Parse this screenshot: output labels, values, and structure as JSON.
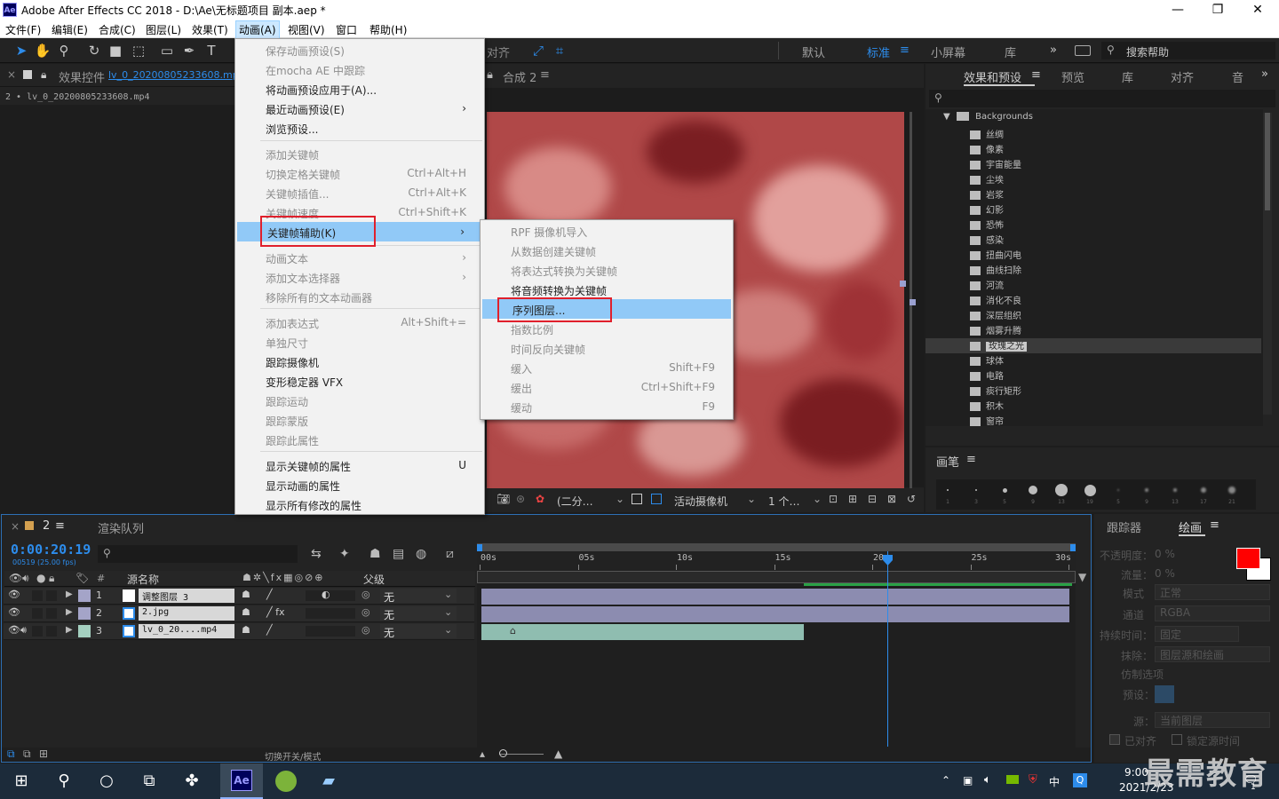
{
  "window": {
    "app_logo": "Ae",
    "title": "Adobe After Effects CC 2018 - D:\\Ae\\无标题项目 副本.aep *",
    "min": "—",
    "max": "❐",
    "close": "✕"
  },
  "menubar": [
    "文件(F)",
    "编辑(E)",
    "合成(C)",
    "图层(L)",
    "效果(T)",
    "动画(A)",
    "视图(V)",
    "窗口",
    "帮助(H)"
  ],
  "toolbar": {
    "align_label": "对齐",
    "workspaces": [
      "默认",
      "标准",
      "小屏幕",
      "库"
    ],
    "more": "»",
    "search_placeholder": "搜索帮助"
  },
  "effect_controls": {
    "tab_prefix": "效果控件",
    "tab_file": "lv_0_20200805233608.mp4",
    "breadcrumb": "2 • lv_0_20200805233608.mp4"
  },
  "composition": {
    "tab": "合成 2"
  },
  "viewer_bar": {
    "resolution": "(二分…",
    "camera": "活动摄像机",
    "views": "1 个…"
  },
  "effects_panel": {
    "tabs": [
      "效果和预设",
      "预览",
      "库",
      "对齐",
      "音"
    ],
    "folder": "Backgrounds",
    "items": [
      "丝绸",
      "像素",
      "宇宙能量",
      "尘埃",
      "岩浆",
      "幻影",
      "恐怖",
      "感染",
      "扭曲闪电",
      "曲线扫除",
      "河流",
      "消化不良",
      "深层组织",
      "烟雾升腾",
      "玫瑰之光",
      "球体",
      "电路",
      "痰行矩形",
      "积木",
      "窗帘"
    ],
    "selected_index": 14
  },
  "brush_panel": {
    "title": "画笔",
    "sizes": [
      "1",
      "3",
      "5",
      "9",
      "13",
      "19",
      "5",
      "9",
      "13",
      "17",
      "21"
    ]
  },
  "paint_panel": {
    "tabs": [
      "跟踪器",
      "绘画"
    ],
    "opacity_label": "不透明度：",
    "opacity_value": "0 %",
    "flow_label": "流量：",
    "flow_value": "0 %",
    "mode_label": "模式",
    "mode_value": "正常",
    "channel_label": "通道",
    "channel_value": "RGBA",
    "duration_label": "持续时间：",
    "duration_value": "固定",
    "erase_label": "抹除：",
    "erase_value": "图层源和绘画",
    "clone_label": "仿制选项",
    "preset_label": "预设：",
    "source_label": "源：",
    "source_value": "当前图层",
    "aligned_label": "已对齐",
    "lock_time_label": "锁定源时间",
    "fg_color": "#ff0000",
    "bg_color": "#ffffff"
  },
  "animation_menu": {
    "items": [
      {
        "label": "保存动画预设(S)",
        "shortcut": "",
        "disabled": true
      },
      {
        "label": "在mocha AE 中跟踪",
        "shortcut": "",
        "disabled": true
      },
      {
        "label": "将动画预设应用于(A)...",
        "shortcut": "",
        "disabled": false
      },
      {
        "label": "最近动画预设(E)",
        "shortcut": "›",
        "disabled": false
      },
      {
        "label": "浏览预设...",
        "shortcut": "",
        "disabled": false
      },
      {
        "label": "添加关键帧",
        "shortcut": "",
        "disabled": true
      },
      {
        "label": "切换定格关键帧",
        "shortcut": "Ctrl+Alt+H",
        "disabled": true
      },
      {
        "label": "关键帧插值...",
        "shortcut": "Ctrl+Alt+K",
        "disabled": true
      },
      {
        "label": "关键帧速度...",
        "shortcut": "Ctrl+Shift+K",
        "disabled": true
      },
      {
        "label": "关键帧辅助(K)",
        "shortcut": "›",
        "disabled": false
      },
      {
        "label": "动画文本",
        "shortcut": "›",
        "disabled": true
      },
      {
        "label": "添加文本选择器",
        "shortcut": "›",
        "disabled": true
      },
      {
        "label": "移除所有的文本动画器",
        "shortcut": "",
        "disabled": true
      },
      {
        "label": "添加表达式",
        "shortcut": "Alt+Shift+=",
        "disabled": true
      },
      {
        "label": "单独尺寸",
        "shortcut": "",
        "disabled": true
      },
      {
        "label": "跟踪摄像机",
        "shortcut": "",
        "disabled": false
      },
      {
        "label": "变形稳定器 VFX",
        "shortcut": "",
        "disabled": false
      },
      {
        "label": "跟踪运动",
        "shortcut": "",
        "disabled": true
      },
      {
        "label": "跟踪蒙版",
        "shortcut": "",
        "disabled": true
      },
      {
        "label": "跟踪此属性",
        "shortcut": "",
        "disabled": true
      },
      {
        "label": "显示关键帧的属性",
        "shortcut": "U",
        "disabled": false
      },
      {
        "label": "显示动画的属性",
        "shortcut": "",
        "disabled": false
      },
      {
        "label": "显示所有修改的属性",
        "shortcut": "",
        "disabled": false
      }
    ]
  },
  "keyframe_submenu": {
    "items": [
      {
        "label": "RPF 摄像机导入",
        "shortcut": "",
        "disabled": true
      },
      {
        "label": "从数据创建关键帧",
        "shortcut": "",
        "disabled": true
      },
      {
        "label": "将表达式转换为关键帧",
        "shortcut": "",
        "disabled": true
      },
      {
        "label": "将音频转换为关键帧",
        "shortcut": "",
        "disabled": false
      },
      {
        "label": "序列图层...",
        "shortcut": "",
        "disabled": false
      },
      {
        "label": "指数比例",
        "shortcut": "",
        "disabled": true
      },
      {
        "label": "时间反向关键帧",
        "shortcut": "",
        "disabled": true
      },
      {
        "label": "缓入",
        "shortcut": "Shift+F9",
        "disabled": true
      },
      {
        "label": "缓出",
        "shortcut": "Ctrl+Shift+F9",
        "disabled": true
      },
      {
        "label": "缓动",
        "shortcut": "F9",
        "disabled": true
      }
    ]
  },
  "timeline": {
    "tab_comp": "2",
    "tab_render": "渲染队列",
    "timecode": "0:00:20:19",
    "frame_info": "00519 (25.00 fps)",
    "header_source": "源名称",
    "header_parent": "父级",
    "header_num": "#",
    "layers": [
      {
        "num": "1",
        "name": "调整图层 3",
        "parent": "无",
        "color": "#a4a4c8"
      },
      {
        "num": "2",
        "name": "2.jpg",
        "parent": "无",
        "color": "#a4a4c8"
      },
      {
        "num": "3",
        "name": "lv_0_20....mp4",
        "parent": "无",
        "color": "#a4d0c0"
      }
    ],
    "ruler": [
      "00s",
      "05s",
      "10s",
      "15s",
      "20s",
      "25s",
      "30s"
    ],
    "footer_toggle": "切换开关/模式"
  },
  "taskbar": {
    "time": "9:00",
    "date": "2021/2/23",
    "ime": "中",
    "watermark": "最需教育",
    "notif_count": "1"
  }
}
